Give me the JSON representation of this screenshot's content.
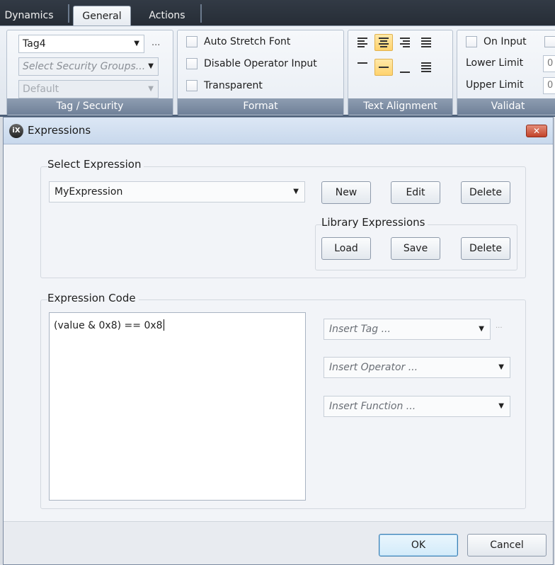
{
  "ribbon": {
    "tabs": [
      "Dynamics",
      "General",
      "Actions"
    ],
    "active_tab": "General",
    "tag_security": {
      "tag_value": "Tag4",
      "ellipsis": "...",
      "security_groups_placeholder": "Select Security Groups...",
      "default_value": "Default",
      "title": "Tag / Security"
    },
    "format": {
      "auto_stretch_font": "Auto Stretch Font",
      "disable_operator_input": "Disable Operator Input",
      "transparent": "Transparent",
      "title": "Format"
    },
    "text_alignment": {
      "title": "Text Alignment",
      "horizontal": [
        "align-left",
        "align-center",
        "align-right",
        "align-justify"
      ],
      "horizontal_selected": "align-center",
      "vertical": [
        "align-top",
        "align-middle",
        "align-bottom",
        "align-stretch"
      ],
      "vertical_selected": "align-middle"
    },
    "validation": {
      "on_input": "On Input",
      "lower_limit": "Lower Limit",
      "lower_value": "0",
      "upper_limit": "Upper Limit",
      "upper_value": "0",
      "title": "Validat"
    }
  },
  "dialog": {
    "icon_text": "iX",
    "title": "Expressions",
    "close_glyph": "✕",
    "select_expression": {
      "label": "Select Expression",
      "value": "MyExpression",
      "new_label": "New",
      "edit_label": "Edit",
      "delete_label": "Delete"
    },
    "library": {
      "label": "Library Expressions",
      "load_label": "Load",
      "save_label": "Save",
      "delete_label": "Delete"
    },
    "expression_code": {
      "label": "Expression Code",
      "code": "(value & 0x8) == 0x8",
      "insert_tag": "Insert Tag ...",
      "tag_ellipsis": "...",
      "insert_operator": "Insert Operator ...",
      "insert_function": "Insert Function ..."
    },
    "ok_label": "OK",
    "cancel_label": "Cancel"
  },
  "colors": {
    "accent_selected": "#ffd36e",
    "title_bar": "#c8d8ec",
    "close_button": "#c2432a"
  }
}
